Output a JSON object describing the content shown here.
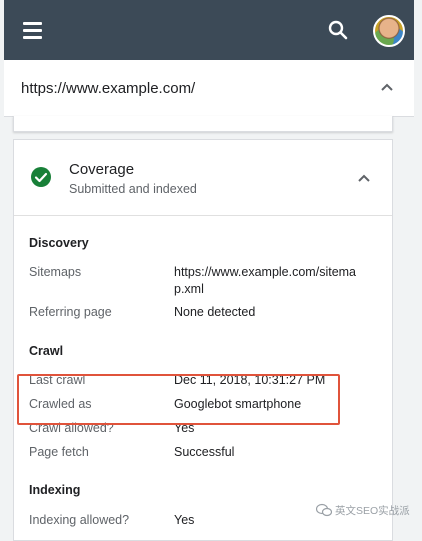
{
  "appbar": {
    "background": "#3c4a57",
    "menu_icon": "menu-icon",
    "search_icon": "search-icon"
  },
  "url_bar": {
    "url": "https://www.example.com/"
  },
  "coverage": {
    "title": "Coverage",
    "status": "Submitted and indexed",
    "status_color": "#188038"
  },
  "discovery": {
    "heading": "Discovery",
    "sitemaps_label": "Sitemaps",
    "sitemaps_value_line1": "https://www.example.com/sitema",
    "sitemaps_value_line2": "p.xml",
    "referring_label": "Referring page",
    "referring_value": "None detected"
  },
  "crawl": {
    "heading": "Crawl",
    "last_crawl_label": "Last crawl",
    "last_crawl_value": "Dec 11, 2018, 10:31:27 PM",
    "crawled_as_label": "Crawled as",
    "crawled_as_value": "Googlebot smartphone",
    "crawl_allowed_label": "Crawl allowed?",
    "crawl_allowed_value": "Yes",
    "page_fetch_label": "Page fetch",
    "page_fetch_value": "Successful"
  },
  "indexing": {
    "heading": "Indexing",
    "indexing_allowed_label": "Indexing allowed?",
    "indexing_allowed_value": "Yes"
  },
  "highlight_color": "#e0533b",
  "watermark": {
    "text": "英文SEO实战派"
  }
}
